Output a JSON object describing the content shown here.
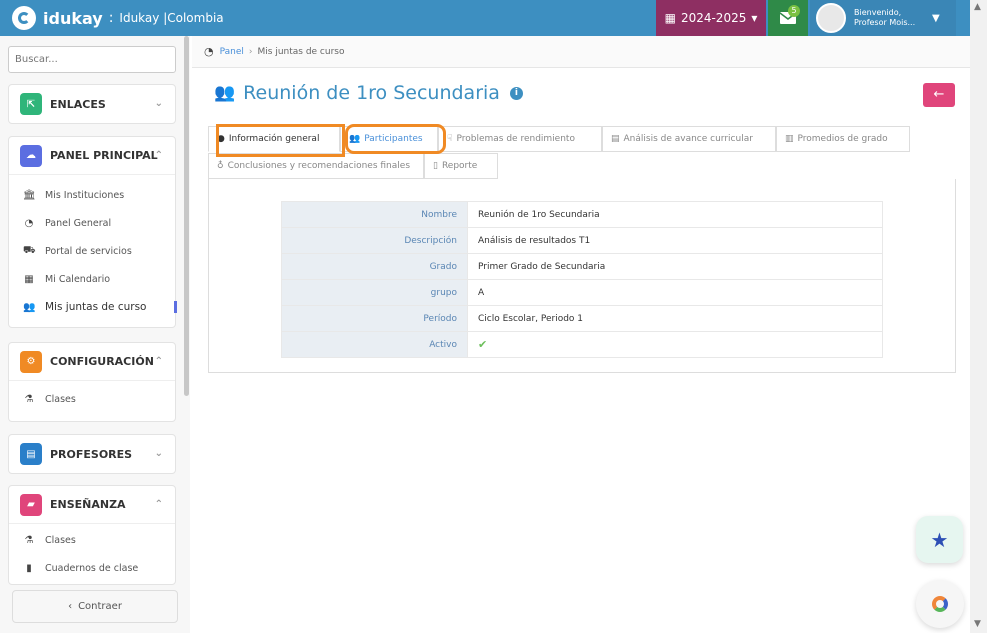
{
  "topbar": {
    "brand": "idukay",
    "separator": ":",
    "institution": "Idukay |Colombia",
    "year_label": "2024-2025",
    "messages_badge": "5",
    "user_greeting": "Bienvenido,",
    "user_name": "Profesor Mois..."
  },
  "sidebar": {
    "search_placeholder": "Buscar...",
    "sections": [
      {
        "label": "ENLACES",
        "color": "#2fb57a"
      },
      {
        "label": "PANEL PRINCIPAL",
        "color": "#5b6ee1",
        "items": [
          "Mis Instituciones",
          "Panel General",
          "Portal de servicios",
          "Mi Calendario",
          "Mis juntas de curso"
        ]
      },
      {
        "label": "CONFIGURACIÓN",
        "color": "#f08a24",
        "items": [
          "Clases"
        ]
      },
      {
        "label": "PROFESORES",
        "color": "#2a7fc9"
      },
      {
        "label": "ENSEÑANZA",
        "color": "#e0457b",
        "items": [
          "Clases",
          "Cuadernos de clase"
        ]
      }
    ],
    "collapse_label": "Contraer"
  },
  "breadcrumb": {
    "home": "Panel",
    "current": "Mis juntas de curso"
  },
  "page": {
    "title": "Reunión de 1ro Secundaria"
  },
  "tabs": [
    "Información general",
    "Participantes",
    "Problemas de rendimiento",
    "Análisis de avance curricular",
    "Promedios de grado",
    "Conclusiones y recomendaciones finales",
    "Reporte"
  ],
  "details": [
    {
      "label": "Nombre",
      "value": "Reunión de 1ro Secundaria"
    },
    {
      "label": "Descripción",
      "value": "Análisis de resultados T1"
    },
    {
      "label": "Grado",
      "value": "Primer Grado de Secundaria"
    },
    {
      "label": "grupo",
      "value": "A"
    },
    {
      "label": "Período",
      "value": "Ciclo Escolar, Periodo 1"
    },
    {
      "label": "Activo",
      "value": ""
    }
  ],
  "colors": {
    "primary": "#3d8fc1",
    "year": "#8e2f62",
    "messages": "#2f8a48",
    "back": "#e0457b",
    "highlight": "#f08a24"
  }
}
